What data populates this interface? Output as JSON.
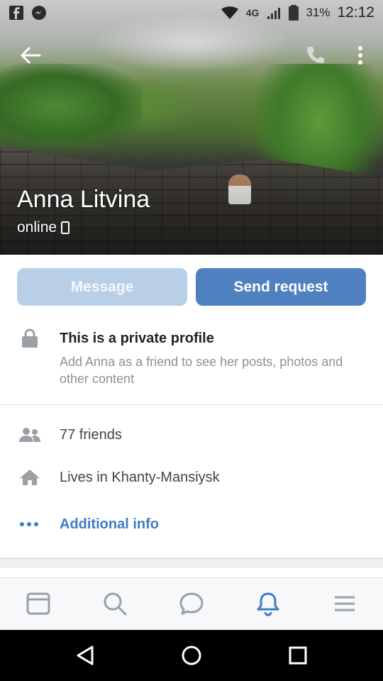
{
  "status_bar": {
    "left_icons": [
      "facebook-icon",
      "messenger-icon"
    ],
    "network": "4G",
    "battery": "31%",
    "time": "12:12"
  },
  "profile": {
    "name": "Anna Litvina",
    "status": "online"
  },
  "actions": {
    "message_label": "Message",
    "send_request_label": "Send request"
  },
  "private_notice": {
    "title": "This is a private profile",
    "text": "Add Anna as a friend to see her posts, photos and other content"
  },
  "info": {
    "friends": "77 friends",
    "location": "Lives in Khanty-Mansiysk",
    "additional": "Additional info"
  },
  "tab_bar": {
    "tabs": [
      "news-icon",
      "search-icon",
      "messages-icon",
      "notifications-icon",
      "menu-icon"
    ],
    "active": "notifications-icon"
  },
  "colors": {
    "accent": "#4f80c0",
    "accent_disabled": "#b8cfe7",
    "link": "#3f7cc2",
    "secondary_text": "#8d9096"
  }
}
